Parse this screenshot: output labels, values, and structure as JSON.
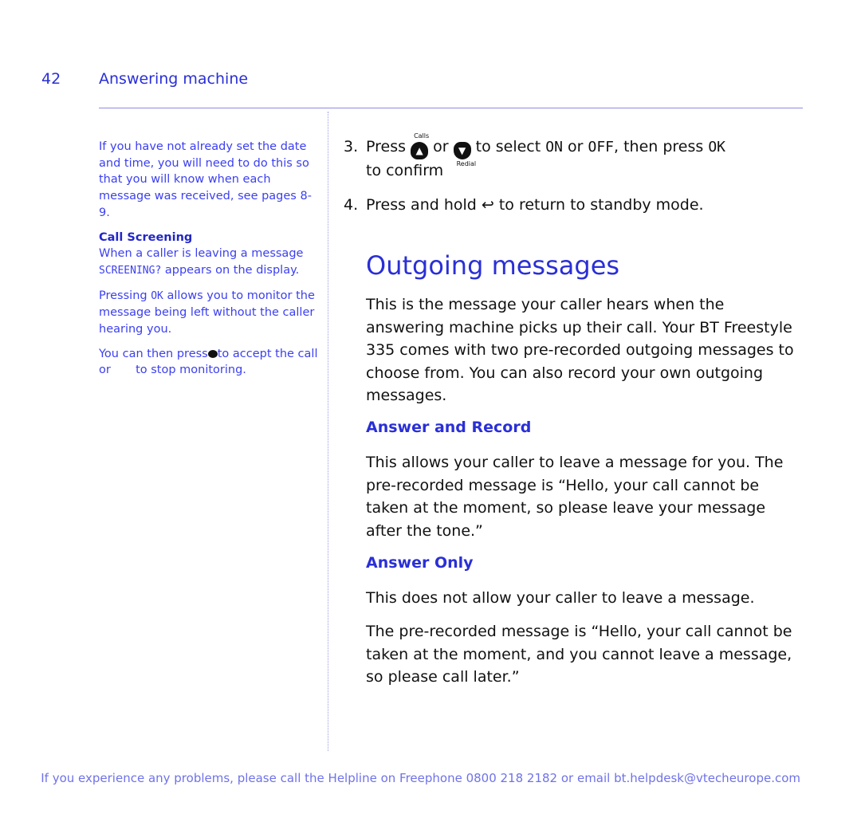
{
  "header": {
    "page_number": "42",
    "section": "Answering machine"
  },
  "sidebar": {
    "note": "If you have not already set the date and time, you will need to do this so that you will know when each message was received, see pages 8-9.",
    "call_screening_title": "Call Screening",
    "cs_p1_a": "When a caller is leaving a message",
    "cs_p1_display": "SCREENING?",
    "cs_p1_b": "appears on the display.",
    "cs_p2_a": "Pressing",
    "cs_p2_key": "OK",
    "cs_p2_b": "allows you to monitor the message being left without the caller hearing you.",
    "cs_p3_a": "You can then press",
    "cs_p3_b": "to accept the call or",
    "cs_p3_c": "to stop monitoring."
  },
  "steps": [
    {
      "num": "3.",
      "a": "Press",
      "calls_label": "Calls",
      "or": "or",
      "redial_label": "Redial",
      "b": "to select",
      "on": "ON",
      "or2": "or",
      "off": "OFF",
      "c": ", then press",
      "ok": "OK",
      "d": "to confirm"
    },
    {
      "num": "4.",
      "a": "Press and hold",
      "b": "to return to standby mode."
    }
  ],
  "outgoing": {
    "title": "Outgoing messages",
    "intro": "This is the message your caller hears when the answering machine picks up their call. Your BT Freestyle 335 comes with two pre-recorded outgoing messages to choose from. You can also record your own outgoing messages.",
    "answer_record_title": "Answer and Record",
    "answer_record_text": "This allows your caller to leave a message for you. The pre-recorded message is “Hello, your call cannot be taken at the moment, so please leave your message after the tone.”",
    "answer_only_title": "Answer Only",
    "answer_only_text1": "This does not allow your caller to leave a message.",
    "answer_only_text2": "The pre-recorded message is “Hello, your call cannot be taken at the moment, and you cannot leave a message, so please call later.”"
  },
  "footer": "If you experience any problems, please call the Helpline on Freephone 0800 218 2182 or email bt.helpdesk@vtecheurope.com"
}
